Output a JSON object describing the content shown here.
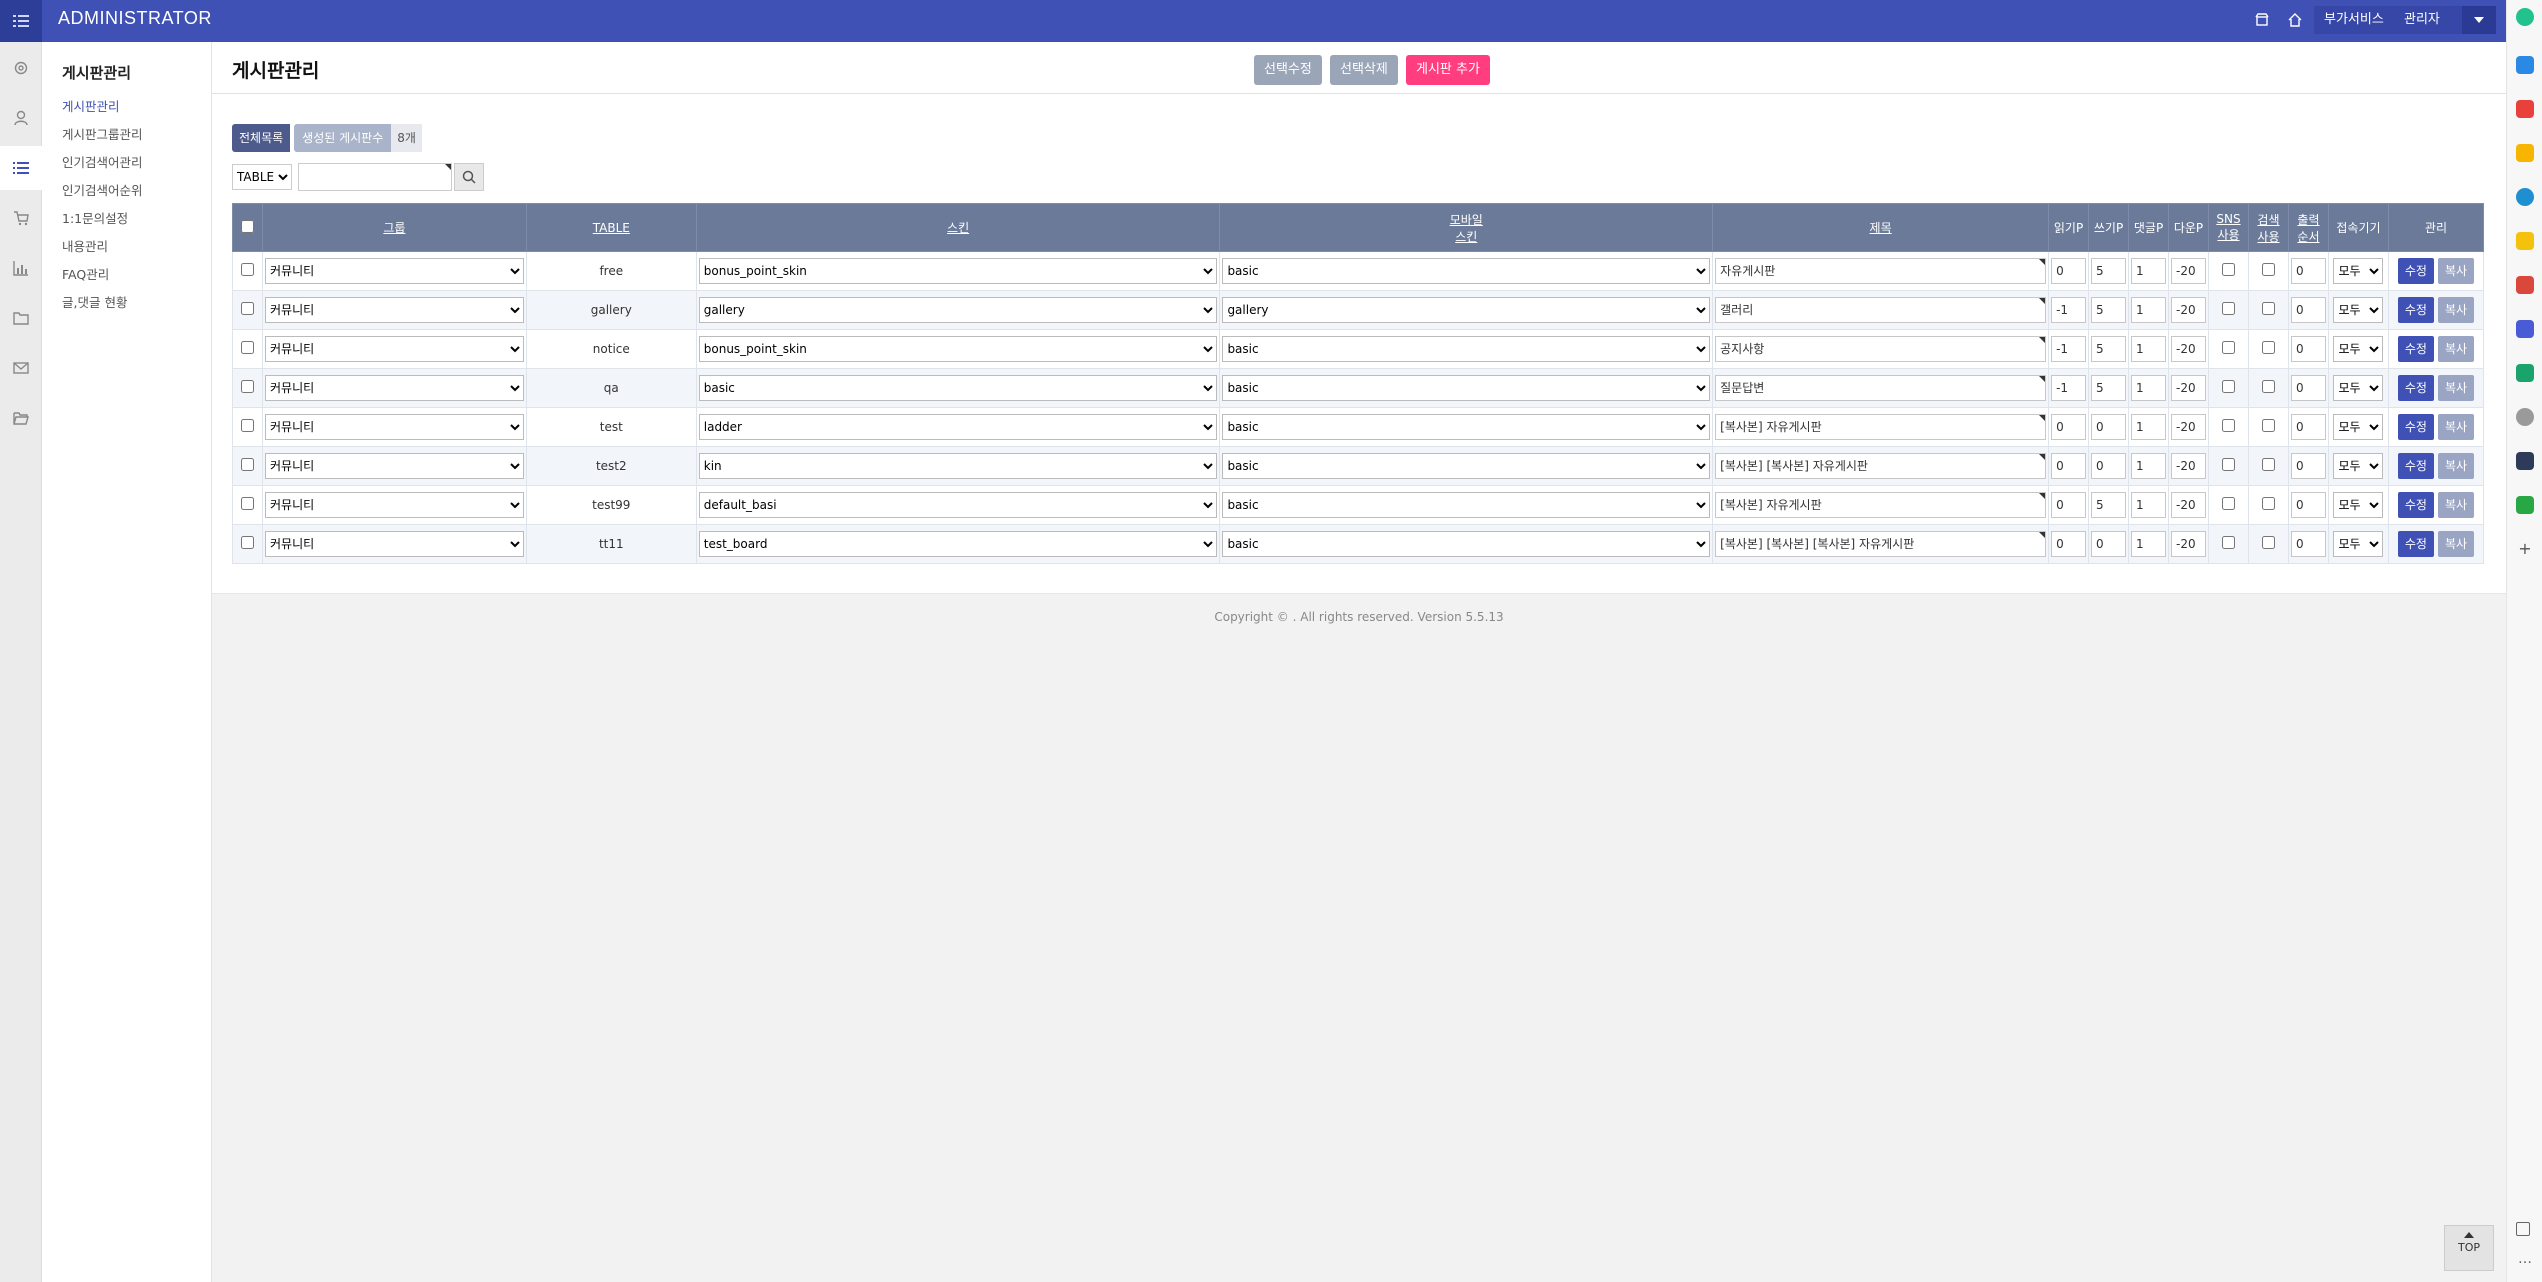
{
  "topbar": {
    "brand": "ADMINISTRATOR",
    "services_label": "부가서비스",
    "admin_label": "관리자"
  },
  "submenu": {
    "title": "게시판관리",
    "items": [
      {
        "label": "게시판관리",
        "active": true
      },
      {
        "label": "게시판그룹관리",
        "active": false
      },
      {
        "label": "인기검색어관리",
        "active": false
      },
      {
        "label": "인기검색어순위",
        "active": false
      },
      {
        "label": "1:1문의설정",
        "active": false
      },
      {
        "label": "내용관리",
        "active": false
      },
      {
        "label": "FAQ관리",
        "active": false
      },
      {
        "label": "글,댓글 현황",
        "active": false
      }
    ]
  },
  "main": {
    "title": "게시판관리",
    "buttons": {
      "edit_selected": "선택수정",
      "delete_selected": "선택삭제",
      "add_board": "게시판 추가"
    },
    "count": {
      "all_label": "전체목록",
      "created_label": "생성된 게시판수",
      "count_value": "8개"
    },
    "search": {
      "field_value": "TABLE",
      "query": ""
    }
  },
  "table": {
    "headers": {
      "group": "그룹",
      "table": "TABLE",
      "skin": "스킨",
      "mobile_skin_1": "모바일",
      "mobile_skin_2": "스킨",
      "subject": "제목",
      "read_point": "읽기P",
      "write_point": "쓰기P",
      "comment_point": "댓글P",
      "download_point": "다운P",
      "sns_1": "SNS",
      "sns_2": "사용",
      "search_1": "검색",
      "search_2": "사용",
      "order_1": "출력",
      "order_2": "순서",
      "device": "접속기기",
      "manage": "관리"
    },
    "edit_label": "수정",
    "copy_label": "복사",
    "rows": [
      {
        "group": "커뮤니티",
        "table": "free",
        "skin": "bonus_point_skin",
        "mobile_skin": "basic",
        "subject": "자유게시판",
        "read": "0",
        "write": "5",
        "comment": "1",
        "download": "-20",
        "order": "0",
        "device": "모두"
      },
      {
        "group": "커뮤니티",
        "table": "gallery",
        "skin": "gallery",
        "mobile_skin": "gallery",
        "subject": "갤러리",
        "read": "-1",
        "write": "5",
        "comment": "1",
        "download": "-20",
        "order": "0",
        "device": "모두"
      },
      {
        "group": "커뮤니티",
        "table": "notice",
        "skin": "bonus_point_skin",
        "mobile_skin": "basic",
        "subject": "공지사항",
        "read": "-1",
        "write": "5",
        "comment": "1",
        "download": "-20",
        "order": "0",
        "device": "모두"
      },
      {
        "group": "커뮤니티",
        "table": "qa",
        "skin": "basic",
        "mobile_skin": "basic",
        "subject": "질문답변",
        "read": "-1",
        "write": "5",
        "comment": "1",
        "download": "-20",
        "order": "0",
        "device": "모두"
      },
      {
        "group": "커뮤니티",
        "table": "test",
        "skin": "ladder",
        "mobile_skin": "basic",
        "subject": "[복사본] 자유게시판",
        "read": "0",
        "write": "0",
        "comment": "1",
        "download": "-20",
        "order": "0",
        "device": "모두"
      },
      {
        "group": "커뮤니티",
        "table": "test2",
        "skin": "kin",
        "mobile_skin": "basic",
        "subject": "[복사본] [복사본] 자유게시판",
        "read": "0",
        "write": "0",
        "comment": "1",
        "download": "-20",
        "order": "0",
        "device": "모두"
      },
      {
        "group": "커뮤니티",
        "table": "test99",
        "skin": "default_basi",
        "mobile_skin": "basic",
        "subject": "[복사본] 자유게시판",
        "read": "0",
        "write": "5",
        "comment": "1",
        "download": "-20",
        "order": "0",
        "device": "모두"
      },
      {
        "group": "커뮤니티",
        "table": "tt11",
        "skin": "test_board",
        "mobile_skin": "basic",
        "subject": "[복사본] [복사본] [복사본] 자유게시판",
        "read": "0",
        "write": "0",
        "comment": "1",
        "download": "-20",
        "order": "0",
        "device": "모두"
      }
    ]
  },
  "footer": {
    "copyright": "Copyright © . All rights reserved. Version 5.5.13",
    "top_label": "TOP"
  },
  "colors": {
    "topbar": "#3f51b5",
    "accent_pink": "#ff3d7f",
    "table_header": "#6b7a99"
  }
}
